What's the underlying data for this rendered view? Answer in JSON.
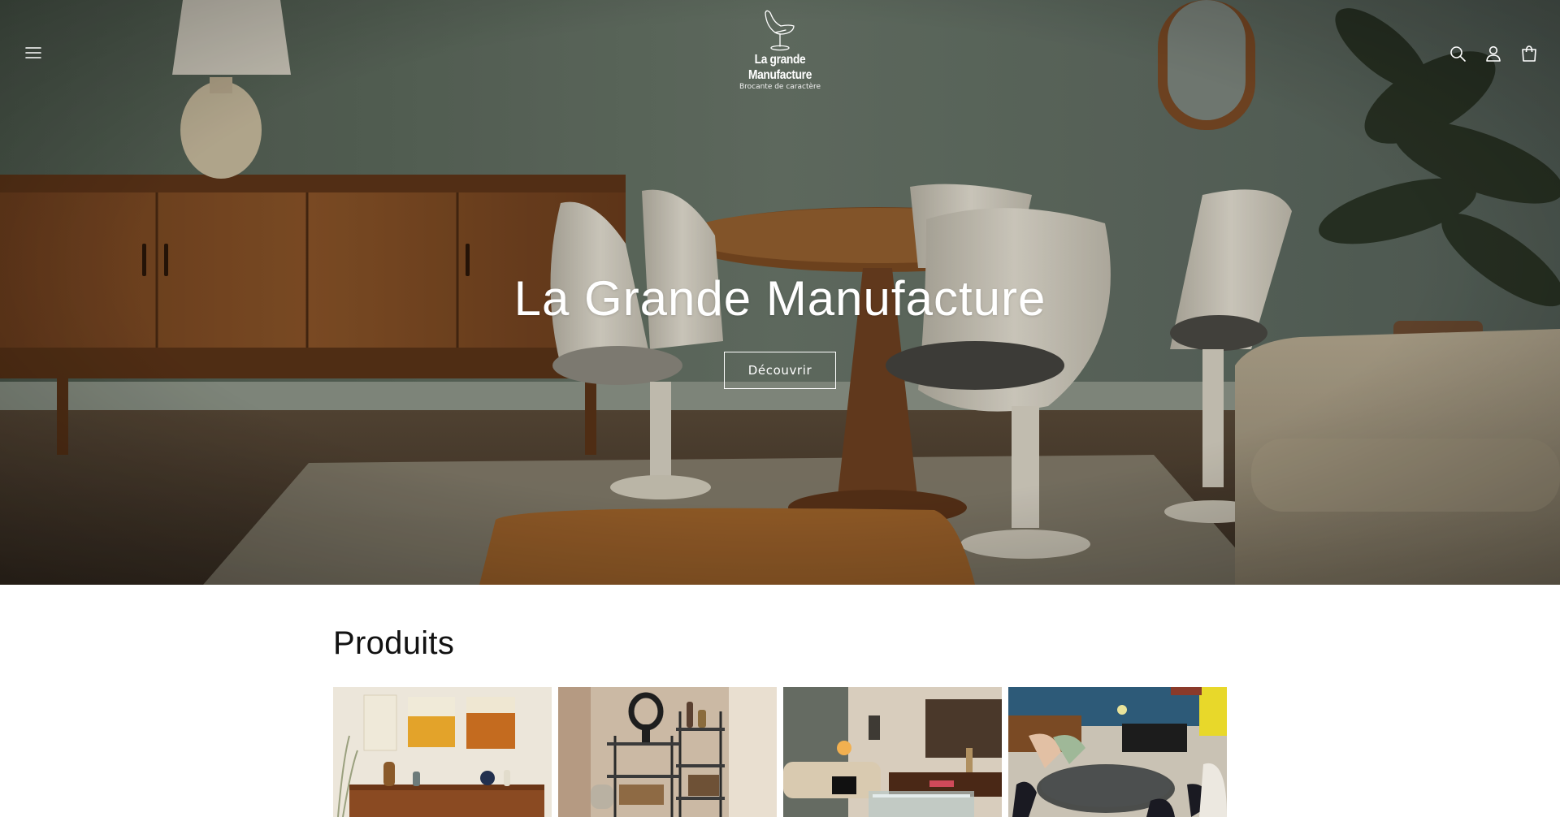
{
  "header": {
    "menu_icon": "hamburger-menu-icon",
    "logo": {
      "icon": "tulip-chair-logo-icon",
      "name_line1": "La grande",
      "name_line2": "Manufacture",
      "tagline": "Brocante de caractère"
    },
    "icons": [
      "search-icon",
      "account-icon",
      "cart-icon"
    ]
  },
  "hero": {
    "title": "La Grande Manufacture",
    "button_label": "Découvrir"
  },
  "products": {
    "title": "Produits",
    "items": [
      {
        "image": "sideboard-with-abstract-paintings"
      },
      {
        "image": "metal-shelving-with-vases"
      },
      {
        "image": "living-room-glass-coffee-table"
      },
      {
        "image": "glass-dining-table-with-chairs"
      }
    ]
  },
  "colors": {
    "wall": "#5d6a5c",
    "button_border": "#ffffff",
    "text": "#121212",
    "background": "#ffffff"
  }
}
